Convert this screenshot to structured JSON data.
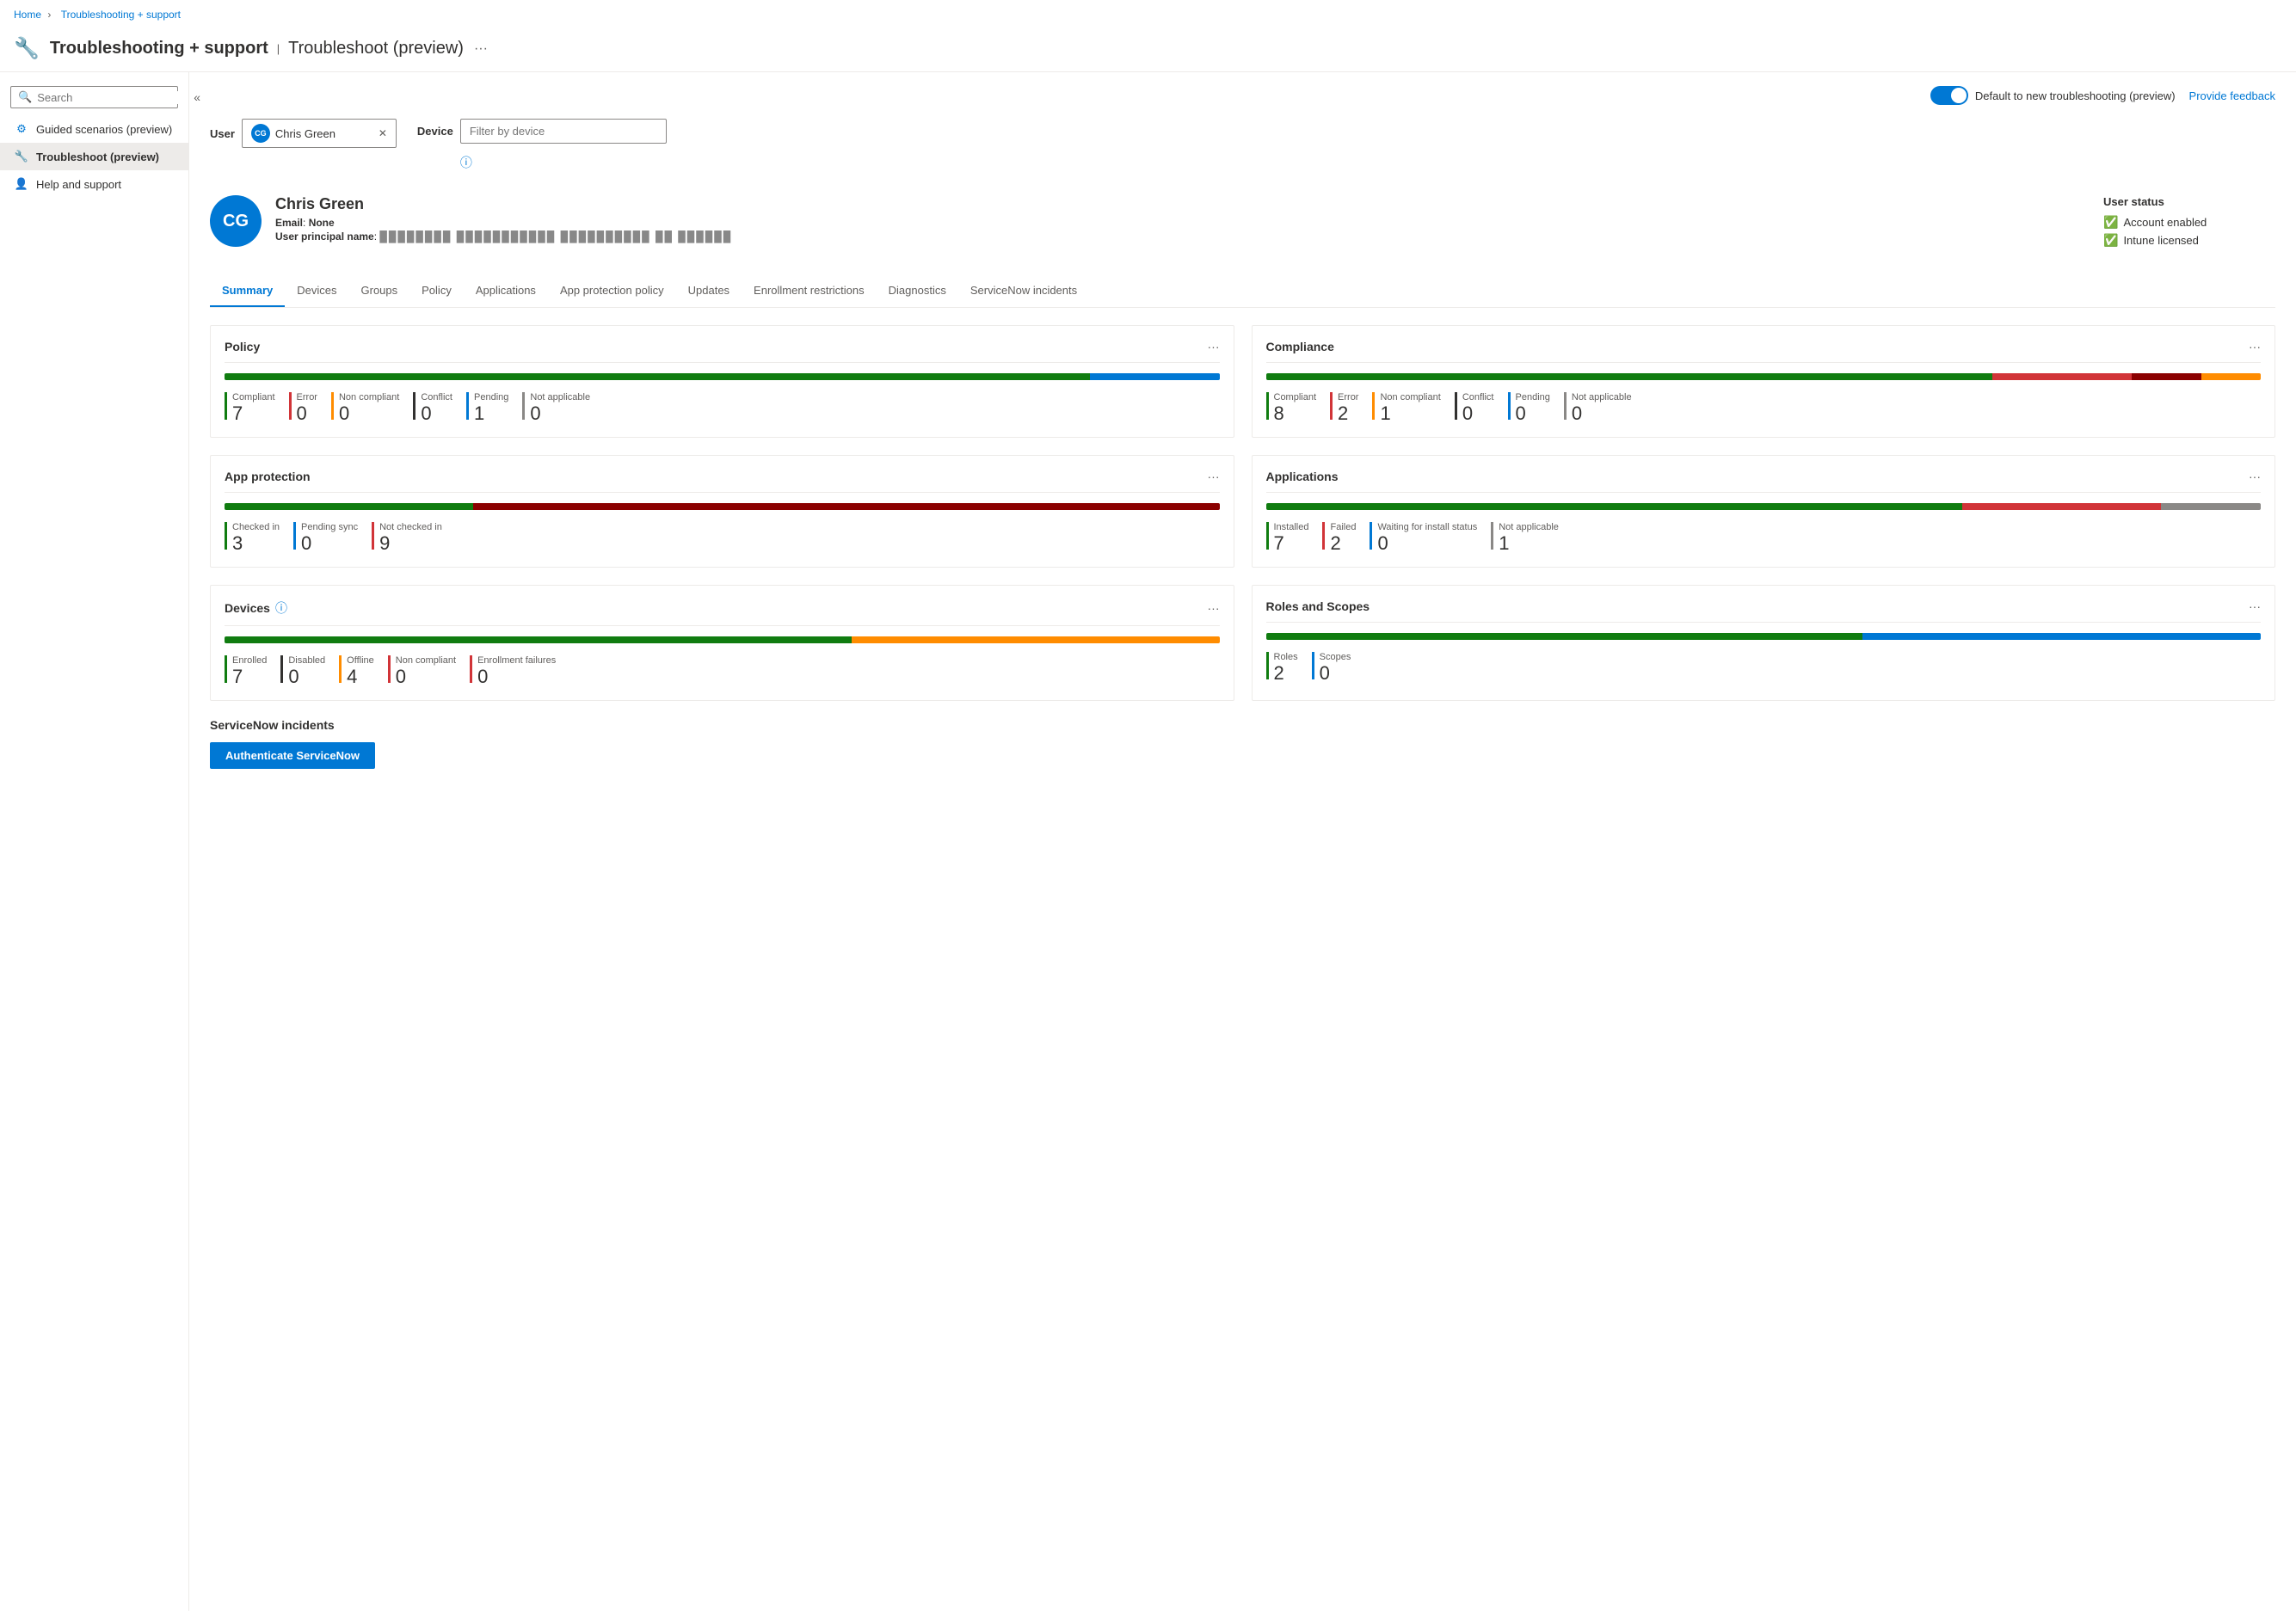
{
  "breadcrumb": {
    "home": "Home",
    "current": "Troubleshooting + support"
  },
  "header": {
    "icon": "🔧",
    "title": "Troubleshooting + support",
    "divider": "|",
    "subtitle": "Troubleshoot (preview)",
    "more": "···"
  },
  "topbar": {
    "toggle_label": "Default to new troubleshooting (preview)",
    "feedback_label": "Provide feedback"
  },
  "sidebar": {
    "search_placeholder": "Search",
    "items": [
      {
        "id": "guided",
        "label": "Guided scenarios (preview)",
        "icon": "⚙"
      },
      {
        "id": "troubleshoot",
        "label": "Troubleshoot (preview)",
        "icon": "🔧"
      },
      {
        "id": "help",
        "label": "Help and support",
        "icon": "👤"
      }
    ]
  },
  "filters": {
    "user_label": "User",
    "user_avatar": "CG",
    "user_name": "Chris Green",
    "device_label": "Device",
    "device_placeholder": "Filter by device",
    "info_icon": "ⓘ"
  },
  "user_profile": {
    "avatar_initials": "CG",
    "name": "Chris Green",
    "email_label": "Email",
    "email_value": "None",
    "upn_label": "User principal name",
    "upn_value": "████████ ███████████ ██████████ ██ ██████",
    "status": {
      "title": "User status",
      "items": [
        {
          "label": "Account enabled",
          "status": "ok"
        },
        {
          "label": "Intune licensed",
          "status": "ok"
        }
      ]
    }
  },
  "tabs": [
    {
      "id": "summary",
      "label": "Summary",
      "active": true
    },
    {
      "id": "devices",
      "label": "Devices"
    },
    {
      "id": "groups",
      "label": "Groups"
    },
    {
      "id": "policy",
      "label": "Policy"
    },
    {
      "id": "applications",
      "label": "Applications"
    },
    {
      "id": "app_protection_policy",
      "label": "App protection policy"
    },
    {
      "id": "updates",
      "label": "Updates"
    },
    {
      "id": "enrollment_restrictions",
      "label": "Enrollment restrictions"
    },
    {
      "id": "diagnostics",
      "label": "Diagnostics"
    },
    {
      "id": "servicenow_incidents",
      "label": "ServiceNow incidents"
    }
  ],
  "cards": {
    "policy": {
      "title": "Policy",
      "bar": [
        {
          "color": "#107c10",
          "pct": 87
        },
        {
          "color": "#0078d4",
          "pct": 13
        }
      ],
      "stats": [
        {
          "label": "Compliant",
          "value": "7",
          "color": "#107c10"
        },
        {
          "label": "Error",
          "value": "0",
          "color": "#d13438"
        },
        {
          "label": "Non compliant",
          "value": "0",
          "color": "#ff8c00"
        },
        {
          "label": "Conflict",
          "value": "0",
          "color": "#323130"
        },
        {
          "label": "Pending",
          "value": "1",
          "color": "#0078d4"
        },
        {
          "label": "Not applicable",
          "value": "0",
          "color": "#8a8886"
        }
      ]
    },
    "compliance": {
      "title": "Compliance",
      "bar": [
        {
          "color": "#107c10",
          "pct": 73
        },
        {
          "color": "#d13438",
          "pct": 14
        },
        {
          "color": "#8b0000",
          "pct": 7
        },
        {
          "color": "#ff8c00",
          "pct": 6
        }
      ],
      "stats": [
        {
          "label": "Compliant",
          "value": "8",
          "color": "#107c10"
        },
        {
          "label": "Error",
          "value": "2",
          "color": "#d13438"
        },
        {
          "label": "Non compliant",
          "value": "1",
          "color": "#ff8c00"
        },
        {
          "label": "Conflict",
          "value": "0",
          "color": "#323130"
        },
        {
          "label": "Pending",
          "value": "0",
          "color": "#0078d4"
        },
        {
          "label": "Not applicable",
          "value": "0",
          "color": "#8a8886"
        }
      ]
    },
    "app_protection": {
      "title": "App protection",
      "bar": [
        {
          "color": "#107c10",
          "pct": 25
        },
        {
          "color": "#8b0000",
          "pct": 75
        }
      ],
      "stats": [
        {
          "label": "Checked in",
          "value": "3",
          "color": "#107c10"
        },
        {
          "label": "Pending sync",
          "value": "0",
          "color": "#0078d4"
        },
        {
          "label": "Not checked in",
          "value": "9",
          "color": "#d13438"
        }
      ]
    },
    "applications": {
      "title": "Applications",
      "bar": [
        {
          "color": "#107c10",
          "pct": 70
        },
        {
          "color": "#d13438",
          "pct": 20
        },
        {
          "color": "#8a8886",
          "pct": 10
        }
      ],
      "stats": [
        {
          "label": "Installed",
          "value": "7",
          "color": "#107c10"
        },
        {
          "label": "Failed",
          "value": "2",
          "color": "#d13438"
        },
        {
          "label": "Waiting for install status",
          "value": "0",
          "color": "#0078d4"
        },
        {
          "label": "Not applicable",
          "value": "1",
          "color": "#8a8886"
        }
      ]
    },
    "devices": {
      "title": "Devices",
      "has_info": true,
      "bar": [
        {
          "color": "#107c10",
          "pct": 63
        },
        {
          "color": "#323130",
          "pct": 0
        },
        {
          "color": "#ff8c00",
          "pct": 37
        },
        {
          "color": "#d13438",
          "pct": 0
        }
      ],
      "stats": [
        {
          "label": "Enrolled",
          "value": "7",
          "color": "#107c10"
        },
        {
          "label": "Disabled",
          "value": "0",
          "color": "#323130"
        },
        {
          "label": "Offline",
          "value": "4",
          "color": "#ff8c00"
        },
        {
          "label": "Non compliant",
          "value": "0",
          "color": "#d13438"
        },
        {
          "label": "Enrollment failures",
          "value": "0",
          "color": "#d13438"
        }
      ]
    },
    "roles_scopes": {
      "title": "Roles and Scopes",
      "bar": [
        {
          "color": "#107c10",
          "pct": 60
        },
        {
          "color": "#0078d4",
          "pct": 40
        }
      ],
      "stats": [
        {
          "label": "Roles",
          "value": "2",
          "color": "#107c10"
        },
        {
          "label": "Scopes",
          "value": "0",
          "color": "#0078d4"
        }
      ]
    }
  },
  "servicenow": {
    "title": "ServiceNow incidents",
    "button_label": "Authenticate ServiceNow"
  }
}
